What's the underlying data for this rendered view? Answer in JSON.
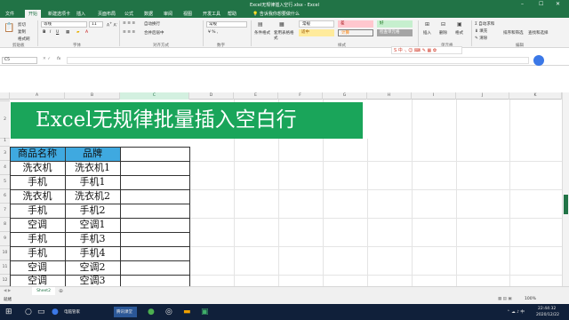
{
  "window": {
    "title": "Excel无规律插入空行.xlsx - Excel",
    "minimize": "–",
    "maximize": "☐",
    "close": "✕"
  },
  "tabs": [
    "文件",
    "开始",
    "新建选项卡",
    "插入",
    "页面布局",
    "公式",
    "数据",
    "审阅",
    "视图",
    "开发工具",
    "帮助"
  ],
  "tell_me": "告诉我你想要做什么",
  "ribbon": {
    "clipboard": {
      "cut": "剪切",
      "copy": "复制",
      "painter": "格式刷"
    },
    "font_name": "等线",
    "font_size": "11",
    "wrap": "自动换行",
    "merge": "合并后居中",
    "number_format": "常规",
    "cond_format": "条件格式",
    "table_format": "套用表格格式",
    "styles": {
      "normal": "常规",
      "bad": "差",
      "good": "好",
      "neutral": "适中",
      "calc": "计算",
      "check": "检查单元格"
    },
    "cells": {
      "insert": "插入",
      "delete": "删除",
      "format": "格式"
    },
    "editing": {
      "autosum": "自动求和",
      "fill": "填充",
      "clear": "清除",
      "sort": "排序和筛选",
      "find": "查找和选择"
    },
    "groups": [
      "剪贴板",
      "字体",
      "对齐方式",
      "数字",
      "样式",
      "单元格",
      "编辑"
    ]
  },
  "formula_bar": {
    "name_box": "C5",
    "fx": "fx"
  },
  "columns": [
    "A",
    "B",
    "C",
    "D",
    "E",
    "F",
    "G",
    "H",
    "I",
    "J",
    "K"
  ],
  "rows": [
    "1",
    "2",
    "3",
    "4",
    "5",
    "6",
    "7",
    "8",
    "9",
    "10",
    "11",
    "12"
  ],
  "banner_text": "Excel无规律批量插入空白行",
  "table": {
    "headers": [
      "商品名称",
      "品牌"
    ],
    "rows": [
      [
        "洗衣机",
        "洗衣机1"
      ],
      [
        "手机",
        "手机1"
      ],
      [
        "洗衣机",
        "洗衣机2"
      ],
      [
        "手机",
        "手机2"
      ],
      [
        "空调",
        "空调1"
      ],
      [
        "手机",
        "手机3"
      ],
      [
        "手机",
        "手机4"
      ],
      [
        "空调",
        "空调2"
      ],
      [
        "空调",
        "空调3"
      ]
    ]
  },
  "sheet_tab": "Sheet2",
  "status": {
    "ready": "就绪",
    "zoom": "100%"
  },
  "taskbar": {
    "app1": "电脑管家",
    "app2": "腾讯课堂",
    "time": "22:44:32",
    "date": "2020/12/22"
  },
  "colors": {
    "excel_green": "#217346",
    "banner_green": "#1aa55a",
    "header_blue": "#3fa9e0"
  }
}
